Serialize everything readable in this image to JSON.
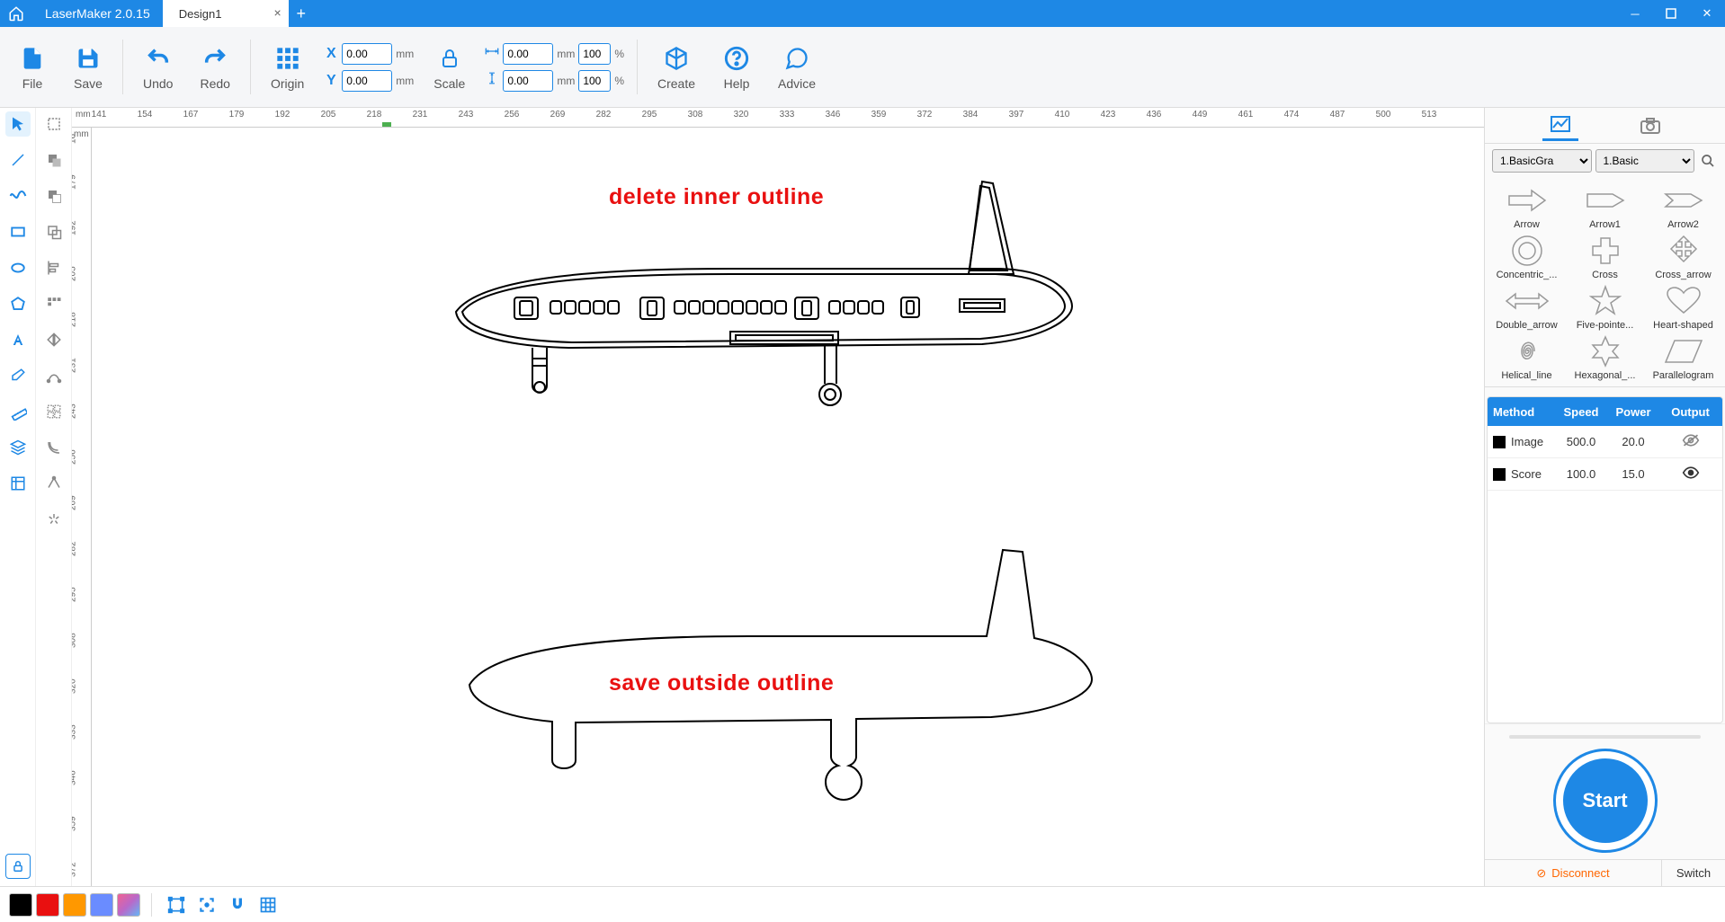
{
  "app": {
    "title": "LaserMaker 2.0.15"
  },
  "tabs": [
    {
      "label": "Design1"
    }
  ],
  "toolbar": {
    "file": "File",
    "save": "Save",
    "undo": "Undo",
    "redo": "Redo",
    "origin": "Origin",
    "scale": "Scale",
    "create": "Create",
    "help": "Help",
    "advice": "Advice"
  },
  "coords": {
    "x_label": "X",
    "x_value": "0.00",
    "x_unit": "mm",
    "y_label": "Y",
    "y_value": "0.00",
    "y_unit": "mm",
    "w_value": "0.00",
    "w_unit": "mm",
    "w_pct": "100",
    "w_pu": "%",
    "h_value": "0.00",
    "h_unit": "mm",
    "h_pct": "100",
    "h_pu": "%"
  },
  "ruler_h": {
    "unit": "mm",
    "ticks": [
      "141",
      "154",
      "167",
      "179",
      "192",
      "205",
      "218",
      "231",
      "243",
      "256",
      "269",
      "282",
      "295",
      "308",
      "320",
      "333",
      "346",
      "359",
      "372",
      "384",
      "397",
      "410",
      "423",
      "436",
      "449",
      "461",
      "474",
      "487",
      "500",
      "513"
    ]
  },
  "ruler_v": {
    "unit": "mm",
    "ticks": [
      "16",
      "179",
      "192",
      "205",
      "218",
      "231",
      "243",
      "256",
      "269",
      "282",
      "295",
      "308",
      "320",
      "333",
      "346",
      "359",
      "372"
    ]
  },
  "canvas": {
    "annotation_top": "delete inner outline",
    "annotation_bottom": "save outside outline"
  },
  "rpanel": {
    "select1": "1.BasicGra",
    "select2": "1.Basic",
    "shapes": [
      "Arrow",
      "Arrow1",
      "Arrow2",
      "Concentric_...",
      "Cross",
      "Cross_arrow",
      "Double_arrow",
      "Five-pointe...",
      "Heart-shaped",
      "Helical_line",
      "Hexagonal_...",
      "Parallelogram"
    ]
  },
  "layers": {
    "head": {
      "method": "Method",
      "speed": "Speed",
      "power": "Power",
      "output": "Output"
    },
    "rows": [
      {
        "name": "Image",
        "speed": "500.0",
        "power": "20.0",
        "visible": false
      },
      {
        "name": "Score",
        "speed": "100.0",
        "power": "15.0",
        "visible": true
      }
    ]
  },
  "start": {
    "label": "Start"
  },
  "connect": {
    "disconnect": "Disconnect",
    "switch": "Switch"
  },
  "colors": [
    "#000000",
    "#e91010",
    "#ff9800",
    "#2196f3",
    "#e879c6"
  ]
}
